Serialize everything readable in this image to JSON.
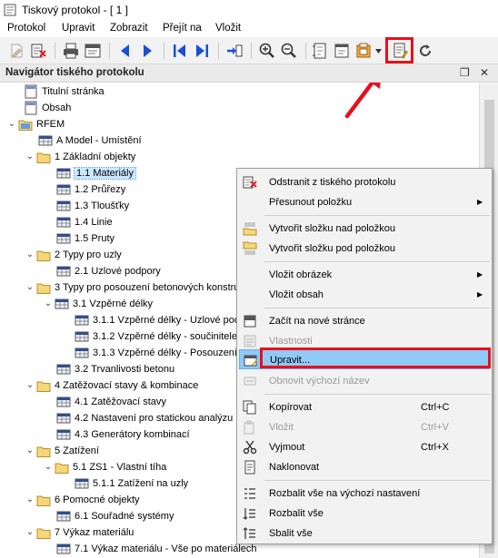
{
  "window": {
    "title": "Tiskový protokol - [ 1 ]"
  },
  "menu": [
    "Protokol",
    "Upravit",
    "Zobrazit",
    "Přejít na",
    "Vložit"
  ],
  "panel": {
    "title": "Navigátor tiského protokolu",
    "pin": "❐",
    "close": "✕"
  },
  "tree": [
    {
      "label": "Titulní stránka",
      "icon": "page-icon"
    },
    {
      "label": "Obsah",
      "icon": "page-icon"
    },
    {
      "label": "RFEM",
      "icon": "folder-icon"
    },
    {
      "label": "A Model - Umístění",
      "icon": "table-icon"
    },
    {
      "label": "1 Základní objekty",
      "icon": "folder-icon"
    },
    {
      "label": "1.1 Materiály",
      "icon": "table-icon"
    },
    {
      "label": "1.2 Průřezy",
      "icon": "table-icon"
    },
    {
      "label": "1.3 Tloušťky",
      "icon": "table-icon"
    },
    {
      "label": "1.4 Linie",
      "icon": "table-icon"
    },
    {
      "label": "1.5 Pruty",
      "icon": "table-icon"
    },
    {
      "label": "2 Typy pro uzly",
      "icon": "folder-icon"
    },
    {
      "label": "2.1 Uzlové podpory",
      "icon": "table-icon"
    },
    {
      "label": "3 Typy pro posouzení betonových konstrukcí",
      "icon": "folder-icon"
    },
    {
      "label": "3.1 Vzpěrné délky",
      "icon": "table-icon"
    },
    {
      "label": "3.1.1 Vzpěrné délky - Uzlové podpory",
      "icon": "table-icon"
    },
    {
      "label": "3.1.2 Vzpěrné délky - součinitele",
      "icon": "table-icon"
    },
    {
      "label": "3.1.3 Vzpěrné délky - Posouzení",
      "icon": "table-icon"
    },
    {
      "label": "3.2 Trvanlivosti betonu",
      "icon": "table-icon"
    },
    {
      "label": "4 Zatěžovací stavy & kombinace",
      "icon": "folder-icon"
    },
    {
      "label": "4.1 Zatěžovací stavy",
      "icon": "table-icon"
    },
    {
      "label": "4.2 Nastavení pro statickou analýzu",
      "icon": "table-icon"
    },
    {
      "label": "4.3 Generátory kombinací",
      "icon": "table-icon"
    },
    {
      "label": "5 Zatížení",
      "icon": "folder-icon"
    },
    {
      "label": "5.1 ZS1 - Vlastní tíha",
      "icon": "folder-icon"
    },
    {
      "label": "5.1.1 Zatížení na uzly",
      "icon": "table-icon"
    },
    {
      "label": "6 Pomocné objekty",
      "icon": "folder-icon"
    },
    {
      "label": "6.1 Souřadné systémy",
      "icon": "table-icon"
    },
    {
      "label": "7 Výkaz materiálu",
      "icon": "folder-icon"
    },
    {
      "label": "7.1 Výkaz materiálu - Vše po materiálech",
      "icon": "table-icon"
    }
  ],
  "context_menu": [
    {
      "label": "Odstranit z tiského protokolu",
      "shortcut": "",
      "icon": "delete-icon"
    },
    {
      "label": "Přesunout položku",
      "shortcut": "",
      "icon": ""
    },
    {
      "label": "Vytvořit složku nad položkou",
      "shortcut": "",
      "icon": "folder-up-icon"
    },
    {
      "label": "Vytvořit složku pod položkou",
      "shortcut": "",
      "icon": "folder-down-icon"
    },
    {
      "label": "Vložit obrázek",
      "shortcut": "",
      "icon": ""
    },
    {
      "label": "Vložit obsah",
      "shortcut": "",
      "icon": ""
    },
    {
      "label": "Začít na nové stránce",
      "shortcut": "",
      "icon": "new-page-icon"
    },
    {
      "label": "Vlastnosti",
      "shortcut": "",
      "icon": "properties-icon"
    },
    {
      "label": "Upravit...",
      "shortcut": "",
      "icon": "edit-icon"
    },
    {
      "label": "Obnovit výchozí název",
      "shortcut": "",
      "icon": "reset-name-icon"
    },
    {
      "label": "Kopírovat",
      "shortcut": "Ctrl+C",
      "icon": "copy-icon"
    },
    {
      "label": "Vložit",
      "shortcut": "Ctrl+V",
      "icon": "paste-icon"
    },
    {
      "label": "Vyjmout",
      "shortcut": "Ctrl+X",
      "icon": "cut-icon"
    },
    {
      "label": "Naklonovat",
      "shortcut": "",
      "icon": "clone-icon"
    },
    {
      "label": "Rozbalit vše na výchozí nastavení",
      "shortcut": "",
      "icon": "expand-default-icon"
    },
    {
      "label": "Rozbalit vše",
      "shortcut": "",
      "icon": "expand-all-icon"
    },
    {
      "label": "Sbalit vše",
      "shortcut": "",
      "icon": "collapse-all-icon"
    }
  ],
  "colors": {
    "highlight_red": "#e8101c",
    "selection_blue": "#91c9f7",
    "nav_blue": "#1a4fd6"
  }
}
